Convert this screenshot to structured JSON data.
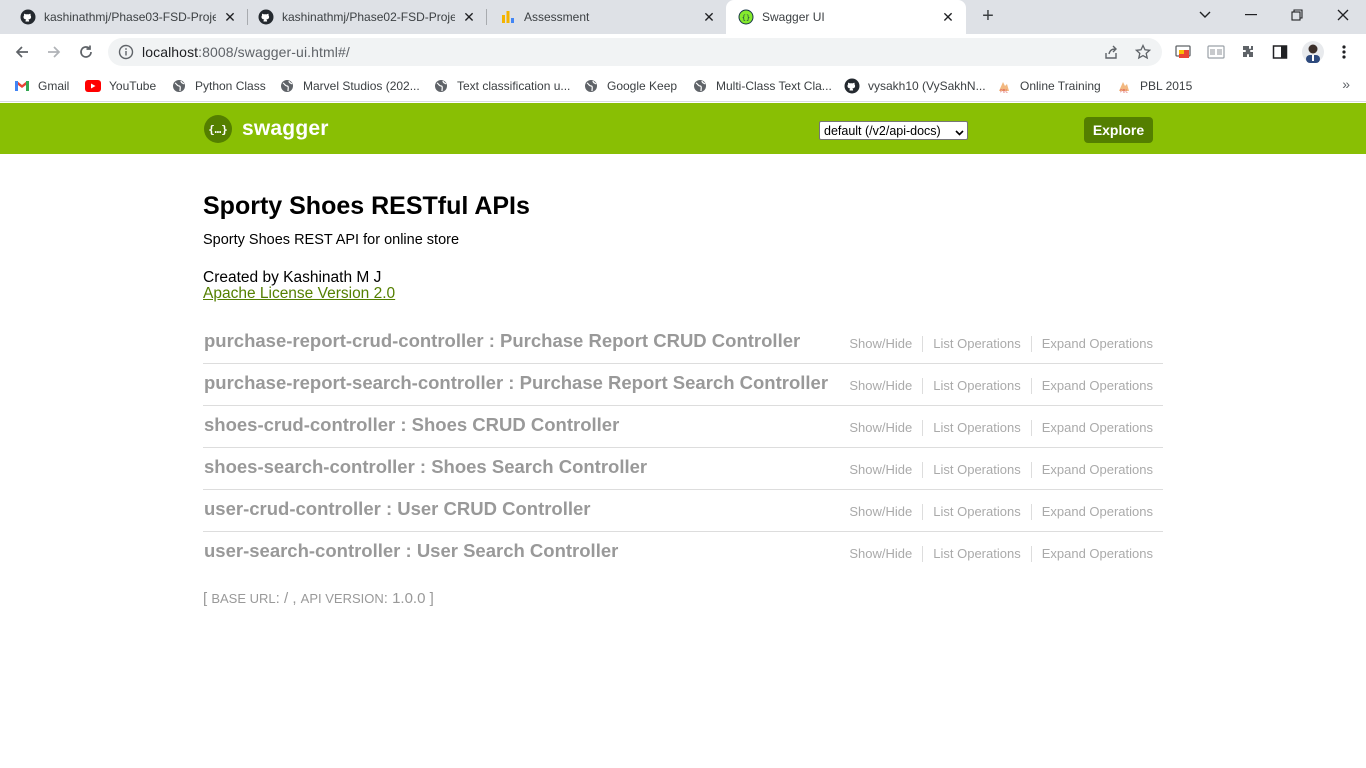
{
  "browser": {
    "tabs": [
      {
        "title": "kashinathmj/Phase03-FSD-Project",
        "icon": "github-icon",
        "active": false
      },
      {
        "title": "kashinathmj/Phase02-FSD-Project",
        "icon": "github-icon",
        "active": false
      },
      {
        "title": "Assessment",
        "icon": "bar-chart-icon",
        "active": false
      },
      {
        "title": "Swagger UI",
        "icon": "swagger-icon",
        "active": true
      }
    ],
    "close_glyph": "✕",
    "new_tab_glyph": "+",
    "url_host": "localhost",
    "url_rest": ":8008/swagger-ui.html#/",
    "bookmarks": [
      {
        "label": "Gmail",
        "icon": "gmail-icon"
      },
      {
        "label": "YouTube",
        "icon": "youtube-icon"
      },
      {
        "label": "Python Class",
        "icon": "globe-icon"
      },
      {
        "label": "Marvel Studios (202...",
        "icon": "globe-icon"
      },
      {
        "label": "Text classification u...",
        "icon": "globe-icon"
      },
      {
        "label": "Google Keep",
        "icon": "globe-icon"
      },
      {
        "label": "Multi-Class Text Cla...",
        "icon": "globe-icon"
      },
      {
        "label": "vysakh10 (VySakhN...",
        "icon": "github-icon"
      },
      {
        "label": "Online Training",
        "icon": "pbl-icon"
      },
      {
        "label": "PBL 2015",
        "icon": "pbl-icon"
      }
    ],
    "bookmarks_more": "»"
  },
  "swagger": {
    "logo_text": "swagger",
    "logo_glyph": "{…}",
    "spec_select": "default (/v2/api-docs)",
    "explore_label": "Explore",
    "accent": "#89bf04",
    "accent_dark": "#547f00"
  },
  "info": {
    "title": "Sporty Shoes RESTful APIs",
    "description": "Sporty Shoes REST API for online store",
    "created_by": "Created by Kashinath M J",
    "license": "Apache License Version 2.0"
  },
  "resources": [
    {
      "heading": "purchase-report-crud-controller : Purchase Report CRUD Controller"
    },
    {
      "heading": "purchase-report-search-controller : Purchase Report Search Controller"
    },
    {
      "heading": "shoes-crud-controller : Shoes CRUD Controller"
    },
    {
      "heading": "shoes-search-controller : Shoes Search Controller"
    },
    {
      "heading": "user-crud-controller : User CRUD Controller"
    },
    {
      "heading": "user-search-controller : User Search Controller"
    }
  ],
  "operations": {
    "show_hide": "Show/Hide",
    "list": "List Operations",
    "expand": "Expand Operations"
  },
  "footer": {
    "open": "[",
    "base_url_label": "BASE URL",
    "base_url_value": ": / ,",
    "api_version_label": "API VERSION",
    "api_version_value": ": 1.0.0",
    "close": "]"
  }
}
